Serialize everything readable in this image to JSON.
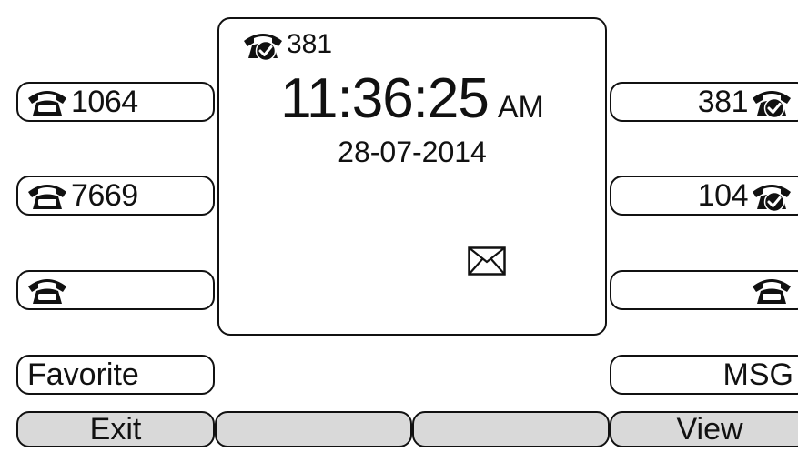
{
  "center": {
    "account_label": "381",
    "time": "11:36:25",
    "ampm": "AM",
    "date": "28-07-2014",
    "icons": {
      "account": "registered-phone-icon",
      "message": "envelope-icon"
    }
  },
  "left_line_keys": [
    {
      "label": "1064",
      "icon": "phone-icon"
    },
    {
      "label": "7669",
      "icon": "phone-icon"
    },
    {
      "label": "",
      "icon": "phone-icon"
    }
  ],
  "right_line_keys": [
    {
      "label": "381",
      "icon": "registered-phone-icon"
    },
    {
      "label": "104",
      "icon": "registered-phone-icon"
    },
    {
      "label": "",
      "icon": "phone-icon"
    }
  ],
  "function_keys": {
    "left": "Favorite",
    "right": "MSG"
  },
  "soft_keys": [
    "Exit",
    "",
    "",
    "View"
  ]
}
